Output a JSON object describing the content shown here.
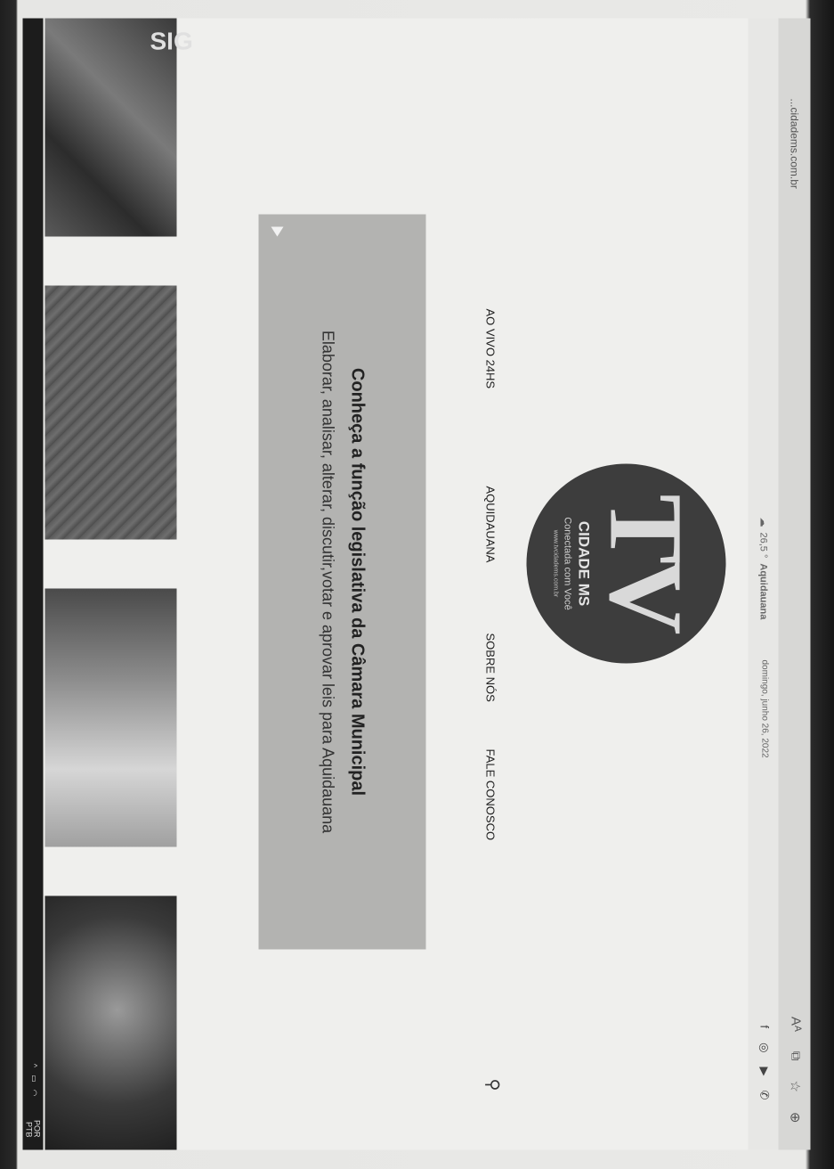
{
  "browser": {
    "tab_title": "...cidadems.com.br",
    "icons": [
      "font-size-icon",
      "tab-icon",
      "favorites-icon",
      "extensions-icon"
    ]
  },
  "infobar": {
    "weather": "26,5 °",
    "city": "Aquidauana",
    "date": "domingo, junho 26, 2022"
  },
  "social": [
    "facebook-icon",
    "instagram-icon",
    "youtube-icon",
    "whatsapp-icon"
  ],
  "logo": {
    "tv": "TV",
    "name": "CIDADE MS",
    "slogan": "Conectada com Você",
    "url": "www.tvcidadems.com.br"
  },
  "nav": {
    "items": [
      "AO VIVO 24HS",
      "AQUIDAUANA",
      "SOBRE NÓS",
      "FALE CONOSCO"
    ]
  },
  "banner": {
    "headline": "Conheça a função legislativa da Câmara Municipal",
    "subtitle": "Elaborar, analisar, alterar, discutir,votar e aprovar leis para Aquidauana"
  },
  "thumbnails": {
    "first_tag": "SIG"
  },
  "taskbar": {
    "lang": "POR",
    "lang2": "PTB"
  }
}
